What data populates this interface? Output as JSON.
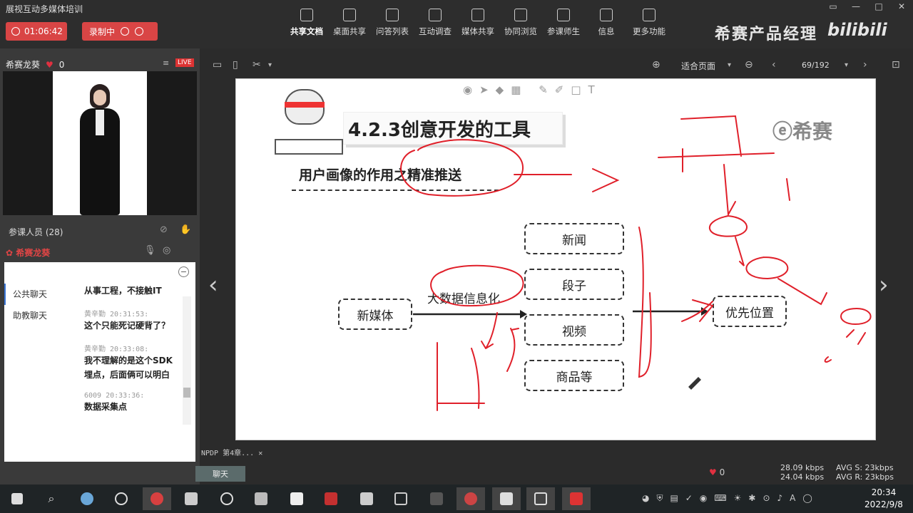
{
  "window": {
    "title": "展视互动多媒体培训"
  },
  "recording": {
    "timer": "01:06:42",
    "rec_label": "录制中"
  },
  "toolbar": {
    "items": [
      {
        "label": "共享文档",
        "icon": "document-icon",
        "active": true
      },
      {
        "label": "桌面共享",
        "icon": "desktop-share-icon"
      },
      {
        "label": "问答列表",
        "icon": "qa-icon"
      },
      {
        "label": "互动调查",
        "icon": "poll-icon"
      },
      {
        "label": "媒体共享",
        "icon": "media-icon"
      },
      {
        "label": "协同浏览",
        "icon": "browse-icon"
      },
      {
        "label": "参课师生",
        "icon": "participants-icon"
      },
      {
        "label": "信息",
        "icon": "info-icon"
      },
      {
        "label": "更多功能",
        "icon": "more-icon"
      }
    ]
  },
  "brand": {
    "text": "希赛产品经理",
    "logo": "bilibili"
  },
  "host": {
    "name": "希赛龙葵",
    "likes": "0",
    "live": "LIVE"
  },
  "participants": {
    "label": "参课人员 (28)"
  },
  "speaker": {
    "name": "希赛龙葵"
  },
  "chat": {
    "tabs": [
      "公共聊天",
      "助教聊天"
    ],
    "messages": [
      {
        "meta": "",
        "text": "从事工程，不接触IT"
      },
      {
        "meta": "黄辛勤 20:31:53:",
        "text": "这个只能死记硬背了？"
      },
      {
        "meta": "黄辛勤 20:33:08:",
        "text": "我不理解的是这个SDK埋点，后面俩可以明白"
      },
      {
        "meta": "6009 20:33:36:",
        "text": "数据采集点"
      }
    ],
    "button": "聊天"
  },
  "doc": {
    "fit_mode": "适合页面",
    "page": "69/192",
    "file": "NPDP 第4章..."
  },
  "slide": {
    "title": "4.2.3创意开发的工具",
    "subtitle": "用户画像的作用之精准推送",
    "logo": "希赛",
    "source": "新媒体",
    "middle": "大数据信息化",
    "items": [
      "新闻",
      "段子",
      "视频",
      "商品等"
    ],
    "target": "优先位置",
    "ink_color": "#e0202a"
  },
  "status": {
    "likes": "0",
    "up": "28.09 kbps",
    "down": "24.04 kbps",
    "avg_s": "AVG S: 23kbps",
    "avg_r": "AVG R: 23kbps"
  },
  "clock": {
    "time": "20:34",
    "date": "2022/9/8"
  }
}
